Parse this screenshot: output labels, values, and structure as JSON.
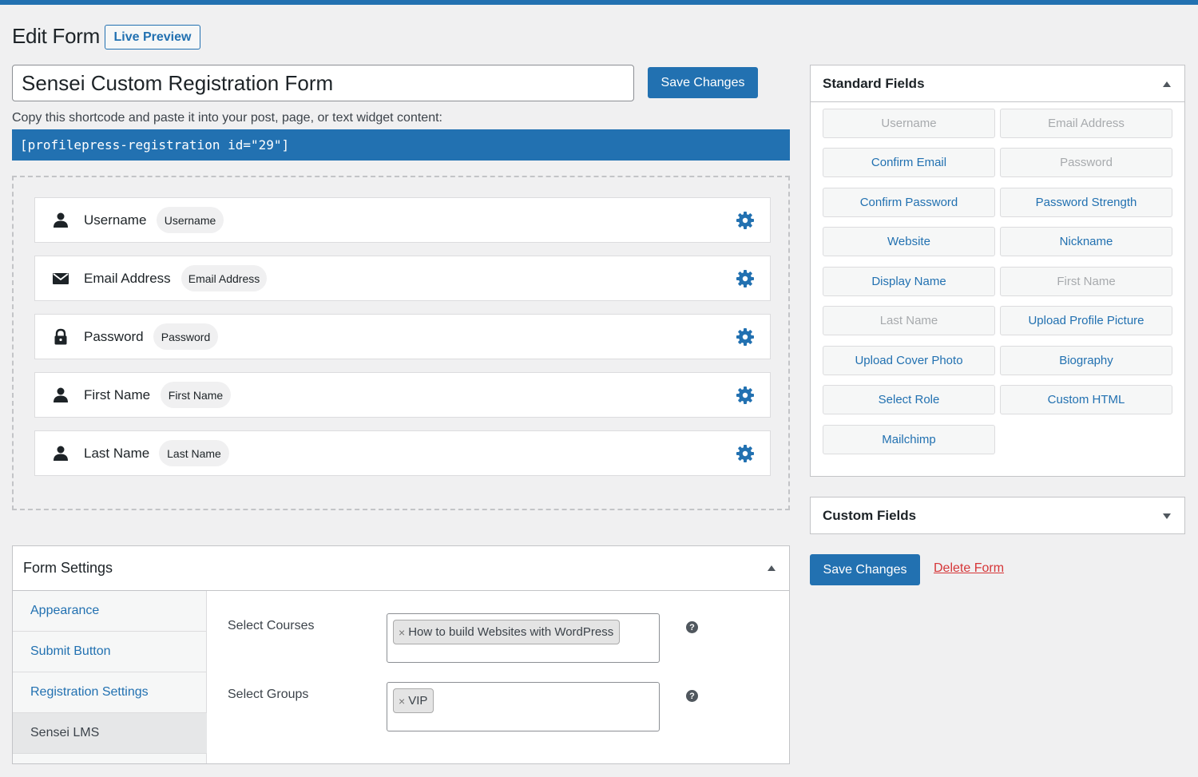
{
  "page": {
    "title": "Edit Form",
    "live_preview_label": "Live Preview",
    "form_name": "Sensei Custom Registration Form",
    "save_label": "Save Changes",
    "shortcode_hint": "Copy this shortcode and paste it into your post, page, or text widget content:",
    "shortcode": "[profilepress-registration id=\"29\"]"
  },
  "builder": {
    "fields": [
      {
        "label": "Username",
        "chip": "Username",
        "icon": "user-icon"
      },
      {
        "label": "Email Address",
        "chip": "Email Address",
        "icon": "envelope-icon"
      },
      {
        "label": "Password",
        "chip": "Password",
        "icon": "lock-icon"
      },
      {
        "label": "First Name",
        "chip": "First Name",
        "icon": "user-icon"
      },
      {
        "label": "Last Name",
        "chip": "Last Name",
        "icon": "user-icon"
      }
    ]
  },
  "settings": {
    "title": "Form Settings",
    "tabs": [
      "Appearance",
      "Submit Button",
      "Registration Settings",
      "Sensei LMS"
    ],
    "active_tab": "Sensei LMS",
    "courses_label": "Select Courses",
    "courses_selected": "How to build Websites with WordPress",
    "groups_label": "Select Groups",
    "groups_selected": "VIP",
    "remove_glyph": "×",
    "help_glyph": "?"
  },
  "standard_fields": {
    "title": "Standard Fields",
    "buttons": [
      {
        "label": "Username",
        "disabled": true
      },
      {
        "label": "Email Address",
        "disabled": true
      },
      {
        "label": "Confirm Email",
        "disabled": false
      },
      {
        "label": "Password",
        "disabled": true
      },
      {
        "label": "Confirm Password",
        "disabled": false
      },
      {
        "label": "Password Strength",
        "disabled": false
      },
      {
        "label": "Website",
        "disabled": false
      },
      {
        "label": "Nickname",
        "disabled": false
      },
      {
        "label": "Display Name",
        "disabled": false
      },
      {
        "label": "First Name",
        "disabled": true
      },
      {
        "label": "Last Name",
        "disabled": true
      },
      {
        "label": "Upload Profile Picture",
        "disabled": false
      },
      {
        "label": "Upload Cover Photo",
        "disabled": false
      },
      {
        "label": "Biography",
        "disabled": false
      },
      {
        "label": "Select Role",
        "disabled": false
      },
      {
        "label": "Custom HTML",
        "disabled": false
      },
      {
        "label": "Mailchimp",
        "disabled": false
      }
    ]
  },
  "custom_fields": {
    "title": "Custom Fields"
  },
  "actions": {
    "save_label": "Save Changes",
    "delete_label": "Delete Form"
  },
  "colors": {
    "accent": "#2271b1",
    "danger": "#d63638",
    "background": "#f0f0f1"
  }
}
